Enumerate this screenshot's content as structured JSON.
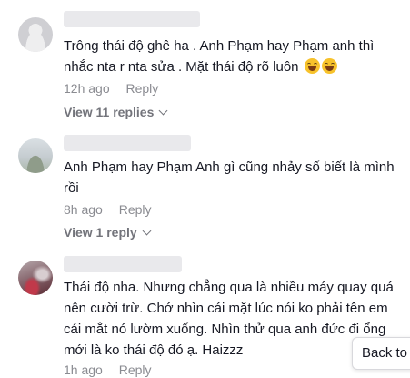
{
  "comments": [
    {
      "text": "Trông thái độ ghê ha . Anh Phạm hay Phạm anh thì nhắc nta r nta sửa . Mặt thái độ rõ luôn",
      "emoji_icons": [
        "rolling-laughing-emoji-icon",
        "rolling-laughing-emoji-icon"
      ],
      "time": "12h ago",
      "reply_label": "Reply",
      "view_replies_label": "View 11 replies"
    },
    {
      "text": "Anh Phạm hay Phạm Anh gì cũng nhảy số biết là mình rồi",
      "time": "8h ago",
      "reply_label": "Reply",
      "view_replies_label": "View 1 reply"
    },
    {
      "text": "Thái độ nha. Nhưng chẳng qua là nhiều máy quay quá nên cười trừ. Chớ nhìn cái mặt lúc nói ko phải tên em cái mắt nó lườm xuống. Nhìn thử qua anh đức đi ổng mới là ko thái độ đó ạ. Haizzz",
      "time": "1h ago",
      "reply_label": "Reply"
    }
  ],
  "back_button_label": "Back to",
  "colors": {
    "text": "#161823",
    "meta": "#8a8b91",
    "view_replies": "#73747b",
    "emoji": "#f7c22b"
  }
}
